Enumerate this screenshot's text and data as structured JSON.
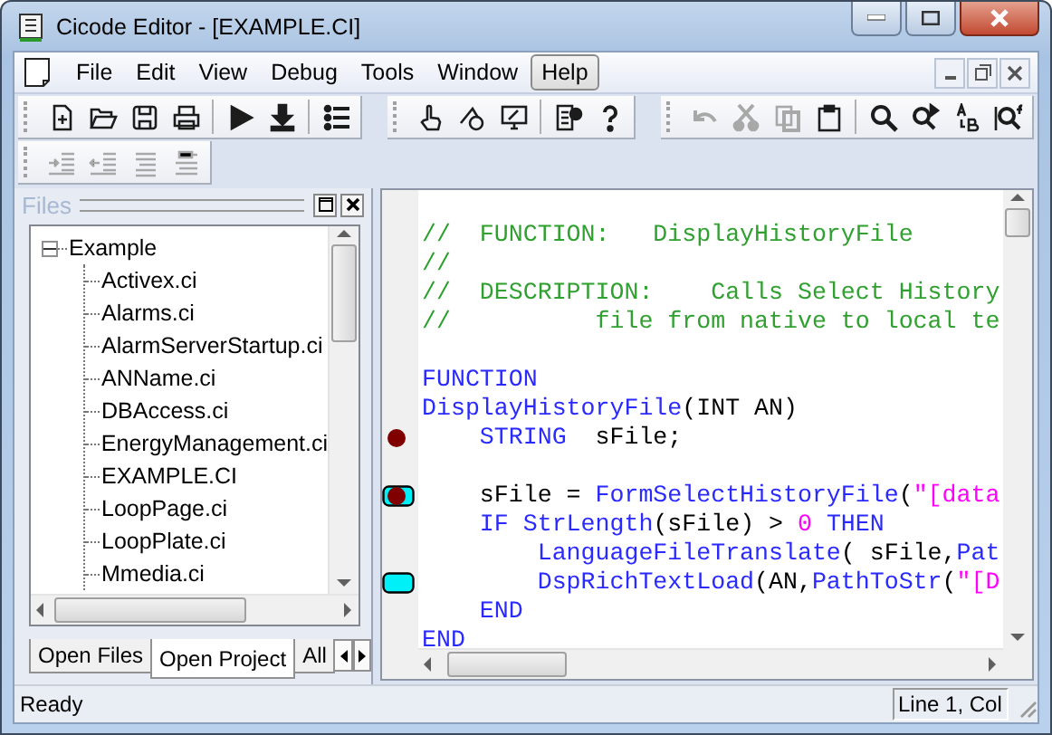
{
  "window": {
    "title": "Cicode Editor - [EXAMPLE.CI]"
  },
  "menu": [
    {
      "label": "File",
      "selected": false
    },
    {
      "label": "Edit",
      "selected": false
    },
    {
      "label": "View",
      "selected": false
    },
    {
      "label": "Debug",
      "selected": false
    },
    {
      "label": "Tools",
      "selected": false
    },
    {
      "label": "Window",
      "selected": false
    },
    {
      "label": "Help",
      "selected": true
    }
  ],
  "toolbar_rows": [
    {
      "groups": [
        {
          "buttons": [
            {
              "disabled": false
            },
            {
              "disabled": false
            },
            {
              "disabled": false
            },
            {
              "disabled": false
            },
            {
              "disabled": false
            },
            {
              "disabled": false
            },
            {
              "disabled": false
            }
          ]
        },
        {
          "buttons": [
            {
              "disabled": false
            },
            {
              "disabled": false
            },
            {
              "disabled": false
            },
            {
              "disabled": false
            },
            {
              "disabled": false
            }
          ]
        },
        {
          "buttons": [
            {
              "disabled": true
            },
            {
              "disabled": true
            },
            {
              "disabled": true
            },
            {
              "disabled": false
            },
            {
              "disabled": false
            },
            {
              "disabled": false
            },
            {
              "disabled": false
            },
            {
              "disabled": false
            }
          ]
        }
      ]
    },
    {
      "groups": [
        {
          "buttons": [
            {
              "disabled": true
            },
            {
              "disabled": true
            },
            {
              "disabled": true
            },
            {
              "disabled": true
            }
          ]
        }
      ]
    }
  ],
  "files_panel": {
    "title": "Files",
    "tree": {
      "label": "Example",
      "expanded": true,
      "children": [
        {
          "label": "Activex.ci"
        },
        {
          "label": "Alarms.ci"
        },
        {
          "label": "AlarmServerStartup.ci"
        },
        {
          "label": "ANName.ci"
        },
        {
          "label": "DBAccess.ci"
        },
        {
          "label": "EnergyManagement.ci"
        },
        {
          "label": "EXAMPLE.CI"
        },
        {
          "label": "LoopPage.ci"
        },
        {
          "label": "LoopPlate.ci"
        },
        {
          "label": "Mmedia.ci"
        }
      ]
    },
    "tabs": [
      {
        "label": "Open Files",
        "selected": false
      },
      {
        "label": "Open Project",
        "selected": true
      },
      {
        "label": "All",
        "selected": false
      }
    ]
  },
  "editor": {
    "lines": [
      {
        "kind": "blank"
      },
      {
        "kind": "code",
        "breakpoint": false,
        "bookmark": false,
        "tokens": [
          {
            "kind": "comment",
            "text": "//  FUNCTION:   DisplayHistoryFile"
          }
        ]
      },
      {
        "kind": "code",
        "breakpoint": false,
        "bookmark": false,
        "tokens": [
          {
            "kind": "comment",
            "text": "//"
          }
        ]
      },
      {
        "kind": "code",
        "breakpoint": false,
        "bookmark": false,
        "tokens": [
          {
            "kind": "comment",
            "text": "//  DESCRIPTION:    Calls Select History"
          }
        ]
      },
      {
        "kind": "code",
        "breakpoint": false,
        "bookmark": false,
        "tokens": [
          {
            "kind": "comment",
            "text": "//          file from native to local te"
          }
        ]
      },
      {
        "kind": "blank"
      },
      {
        "kind": "code",
        "breakpoint": false,
        "bookmark": false,
        "tokens": [
          {
            "kind": "keyword",
            "text": "FUNCTION"
          }
        ]
      },
      {
        "kind": "code",
        "breakpoint": false,
        "bookmark": false,
        "tokens": [
          {
            "kind": "function",
            "text": "DisplayHistoryFile"
          },
          {
            "kind": "plain",
            "text": "(INT AN)"
          }
        ]
      },
      {
        "kind": "code",
        "breakpoint": true,
        "bookmark": false,
        "tokens": [
          {
            "kind": "keyword",
            "text": "    STRING"
          },
          {
            "kind": "plain",
            "text": "  sFile;"
          }
        ]
      },
      {
        "kind": "blank"
      },
      {
        "kind": "code",
        "breakpoint": true,
        "bookmark": true,
        "tokens": [
          {
            "kind": "plain",
            "text": "    sFile = "
          },
          {
            "kind": "function",
            "text": "FormSelectHistoryFile"
          },
          {
            "kind": "plain",
            "text": "("
          },
          {
            "kind": "string",
            "text": "\"[data"
          }
        ]
      },
      {
        "kind": "code",
        "breakpoint": false,
        "bookmark": false,
        "tokens": [
          {
            "kind": "keyword",
            "text": "    IF"
          },
          {
            "kind": "function",
            "text": " StrLength"
          },
          {
            "kind": "plain",
            "text": "(sFile) > "
          },
          {
            "kind": "number",
            "text": "0"
          },
          {
            "kind": "keyword",
            "text": " THEN"
          }
        ]
      },
      {
        "kind": "code",
        "breakpoint": false,
        "bookmark": false,
        "tokens": [
          {
            "kind": "function",
            "text": "        LanguageFileTranslate"
          },
          {
            "kind": "plain",
            "text": "( sFile,"
          },
          {
            "kind": "function",
            "text": "Pat"
          }
        ]
      },
      {
        "kind": "code",
        "breakpoint": false,
        "bookmark": true,
        "tokens": [
          {
            "kind": "function",
            "text": "        DspRichTextLoad"
          },
          {
            "kind": "plain",
            "text": "(AN,"
          },
          {
            "kind": "function",
            "text": "PathToStr"
          },
          {
            "kind": "plain",
            "text": "("
          },
          {
            "kind": "string",
            "text": "\"[D"
          }
        ]
      },
      {
        "kind": "code",
        "breakpoint": false,
        "bookmark": false,
        "tokens": [
          {
            "kind": "keyword",
            "text": "    END"
          }
        ]
      },
      {
        "kind": "code",
        "breakpoint": false,
        "bookmark": false,
        "tokens": [
          {
            "kind": "keyword",
            "text": "END"
          }
        ]
      }
    ]
  },
  "status_bar": {
    "message": "Ready",
    "position": "Line 1, Col"
  }
}
